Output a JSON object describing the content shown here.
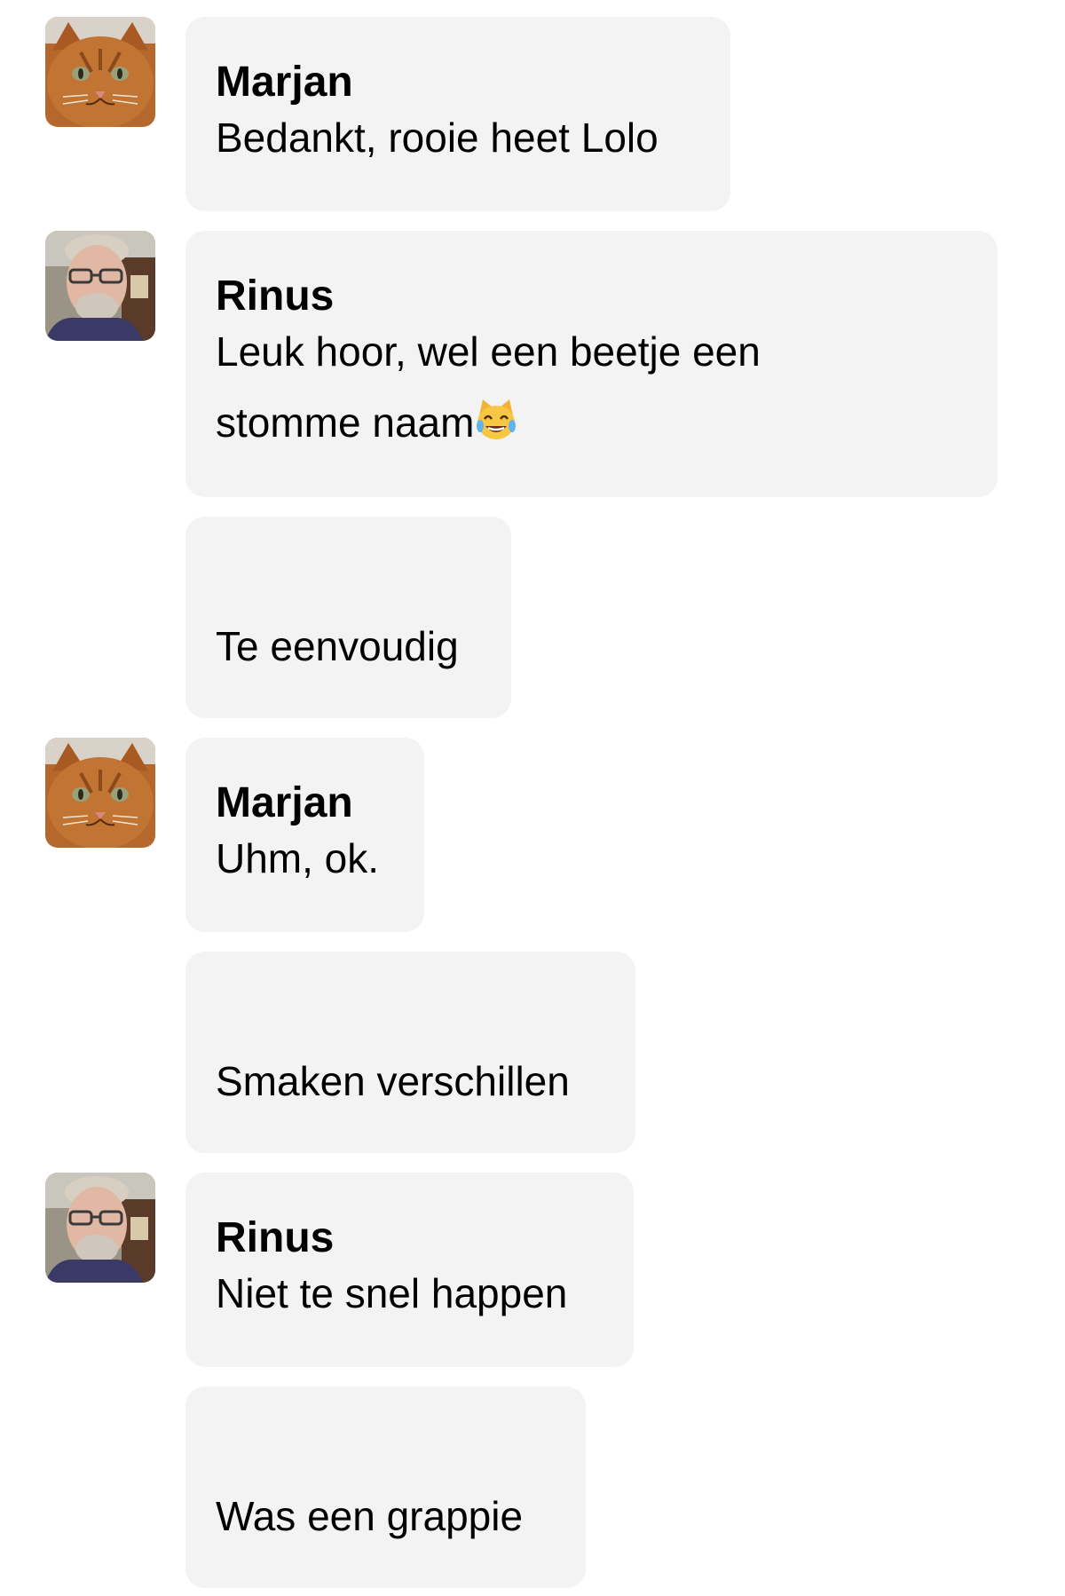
{
  "messages": [
    {
      "sender": "Marjan",
      "avatar": "cat-avatar",
      "text": "Bedankt, rooie heet Lolo"
    },
    {
      "sender": "Rinus",
      "avatar": "man-avatar",
      "text_line1": "Leuk hoor, wel een beetje een",
      "text_line2": "stomme naam",
      "emoji": "laughing-cat-emoji"
    },
    {
      "text": "Te eenvoudig"
    },
    {
      "sender": "Marjan",
      "avatar": "cat-avatar",
      "text": "Uhm, ok."
    },
    {
      "text": "Smaken verschillen"
    },
    {
      "sender": "Rinus",
      "avatar": "man-avatar",
      "text": "Niet te snel happen"
    },
    {
      "text": "Was een grappie"
    }
  ],
  "colors": {
    "bubble": "#f3f3f3",
    "text": "#000000",
    "background": "#ffffff"
  }
}
